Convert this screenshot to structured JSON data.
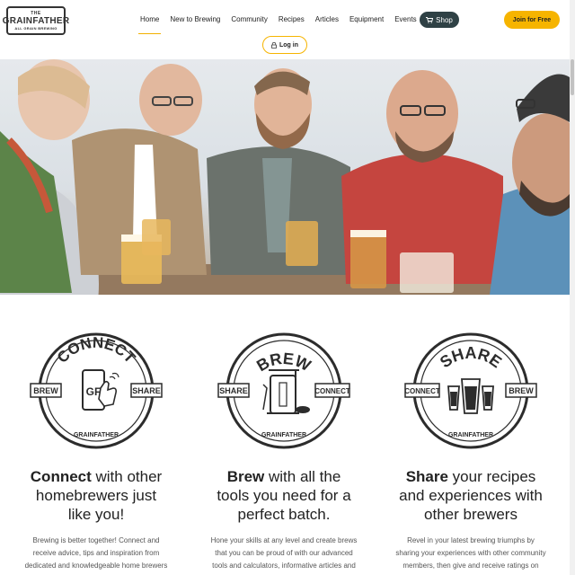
{
  "logo": {
    "top": "THE",
    "main": "GRAINFATHER",
    "sub": "ALL GRAIN BREWING"
  },
  "nav": {
    "items": [
      "Home",
      "New to Brewing",
      "Community",
      "Recipes",
      "Articles",
      "Equipment",
      "Events"
    ],
    "active": "Home"
  },
  "header": {
    "shop_label": "Shop",
    "join_label": "Join for Free",
    "login_label": "Log in"
  },
  "colors": {
    "accent": "#f6b400",
    "shop_bg": "#2f4145"
  },
  "icons": [
    "cart-icon",
    "lock-icon"
  ],
  "features": [
    {
      "badge_word": "CONNECT",
      "badge_left": "BREW",
      "badge_right": "SHARE",
      "badge_brand": "GRAINFATHER",
      "heading_bold": "Connect",
      "heading_rest": " with other homebrewers just like you!",
      "desc": "Brewing is better together! Connect and receive advice, tips and inspiration from dedicated and knowledgeable home brewers and beer lovers just"
    },
    {
      "badge_word": "BREW",
      "badge_left": "SHARE",
      "badge_right": "CONNECT",
      "badge_brand": "GRAINFATHER",
      "heading_bold": "Brew",
      "heading_rest": " with all the tools you need for a perfect batch.",
      "desc": "Hone your skills at any level and create brews that you can be proud of with our advanced tools and calculators, informative articles and tips from"
    },
    {
      "badge_word": "SHARE",
      "badge_left": "CONNECT",
      "badge_right": "BREW",
      "badge_brand": "GRAINFATHER",
      "heading_bold": "Share",
      "heading_rest": " your recipes and experiences with other brewers",
      "desc": "Revel in your latest brewing triumphs by sharing your experiences with other community members, then give and receive ratings on your latest"
    }
  ]
}
